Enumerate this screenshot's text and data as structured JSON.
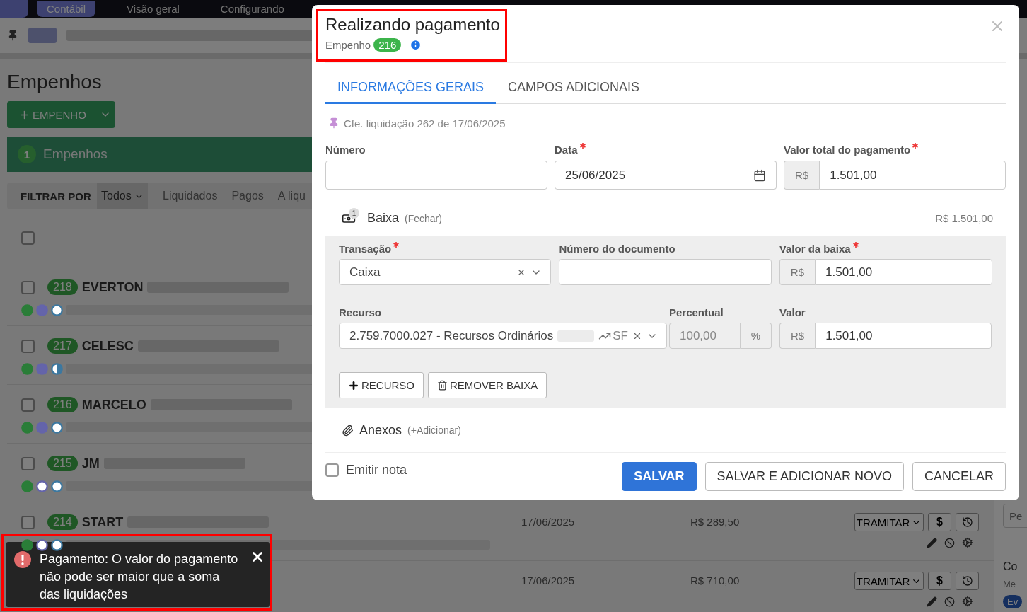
{
  "navbar": {
    "items": [
      {
        "label": "Contábil",
        "selected": true
      },
      {
        "label": "Visão geral",
        "selected": false
      },
      {
        "label": "Configurando",
        "selected": false
      }
    ]
  },
  "page": {
    "title": "Empenhos",
    "add_button": "EMPENHO",
    "summary": {
      "count": "1",
      "label": "Empenhos"
    },
    "filter": {
      "label": "FILTRAR POR",
      "options": [
        {
          "label": "Todos",
          "selected": true
        },
        {
          "label": "Liquidados",
          "selected": false
        },
        {
          "label": "Pagos",
          "selected": false
        },
        {
          "label": "A liqu",
          "selected": false
        }
      ]
    },
    "select_all_checked": false,
    "rows": [
      {
        "checked": false,
        "number": "218",
        "name": "EVERTON",
        "dots": [
          {
            "kind": "filled",
            "color": "#2a7d38"
          },
          {
            "kind": "filled",
            "color": "#6464aa"
          },
          {
            "kind": "outline",
            "color": "#3c78a0"
          }
        ]
      },
      {
        "checked": false,
        "number": "217",
        "name": "CELESC",
        "dots": [
          {
            "kind": "filled",
            "color": "#2a7d38"
          },
          {
            "kind": "filled",
            "color": "#6464aa"
          },
          {
            "kind": "half",
            "color": "#3c78a0"
          }
        ]
      },
      {
        "checked": false,
        "number": "216",
        "name": "MARCELO",
        "dots": [
          {
            "kind": "filled",
            "color": "#2a7d38"
          },
          {
            "kind": "filled",
            "color": "#6464aa"
          },
          {
            "kind": "outline",
            "color": "#3c78a0"
          }
        ]
      },
      {
        "checked": false,
        "number": "215",
        "name": "JM",
        "dots": [
          {
            "kind": "filled",
            "color": "#2a7d38"
          },
          {
            "kind": "outline",
            "color": "#6464aa"
          },
          {
            "kind": "outline",
            "color": "#3c78a0"
          }
        ]
      },
      {
        "checked": false,
        "number": "214",
        "name": "START",
        "dots": [
          {
            "kind": "filled",
            "color": "#2a7d38"
          },
          {
            "kind": "outline",
            "color": "#6464aa"
          },
          {
            "kind": "outline",
            "color": "#3c78a0"
          }
        ],
        "date": "17/06/2025",
        "amount": "R$ 289,50",
        "action": "TRAMITAR",
        "pay": "$"
      },
      {
        "date": "17/06/2025",
        "amount": "R$ 710,00",
        "action": "TRAMITAR",
        "pay": "$"
      }
    ]
  },
  "sidebar": {
    "search_placeholder": "Pe",
    "card_title": "Co",
    "card_subtitle": "Me",
    "card_tag": "Ev"
  },
  "modal": {
    "title": "Realizando pagamento",
    "subtitle": "Empenho",
    "number": "216",
    "tabs": [
      {
        "label": "INFORMAÇÕES GERAIS",
        "selected": true
      },
      {
        "label": "CAMPOS ADICIONAIS",
        "selected": false
      }
    ],
    "note": "Cfe. liquidação 262 de 17/06/2025",
    "fields": [
      {
        "kind": "text",
        "label": "Número",
        "required": false
      },
      {
        "kind": "date",
        "label": "Data",
        "required": true,
        "value": "25/06/2025"
      },
      {
        "kind": "currency",
        "label": "Valor total do pagamento",
        "required": true,
        "prefix": "R$",
        "value": "1.501,00"
      }
    ],
    "baixa": {
      "count": "1",
      "title": "Baixa",
      "toggle": "(Fechar)",
      "total": "R$ 1.501,00",
      "fields": [
        {
          "kind": "select",
          "label": "Transação",
          "required": true,
          "value": "Caixa"
        },
        {
          "kind": "text",
          "label": "Número do documento",
          "required": false
        },
        {
          "kind": "currency",
          "label": "Valor da baixa",
          "required": true,
          "prefix": "R$",
          "value": "1.501,00"
        }
      ],
      "resource_fields": [
        {
          "kind": "resource",
          "label": "Recurso",
          "required": false,
          "value": "2.759.7000.027 - Recursos Ordinários",
          "tag": "SF"
        },
        {
          "kind": "percent",
          "label": "Percentual",
          "required": false,
          "value": "100,00",
          "suffix": "%",
          "disabled": true
        },
        {
          "kind": "currency",
          "label": "Valor",
          "required": false,
          "prefix": "R$",
          "value": "1.501,00"
        }
      ],
      "buttons": [
        {
          "kind": "add",
          "label": "RECURSO"
        },
        {
          "kind": "remove",
          "label": "REMOVER BAIXA"
        }
      ]
    },
    "attachments": {
      "title": "Anexos",
      "action": "(+Adicionar)"
    },
    "emit_note": {
      "label": "Emitir nota",
      "checked": false
    },
    "buttons": [
      {
        "kind": "primary",
        "label": "SALVAR"
      },
      {
        "kind": "default",
        "label": "SALVAR E ADICIONAR NOVO"
      },
      {
        "kind": "default",
        "label": "CANCELAR"
      }
    ]
  },
  "toast": {
    "message": "Pagamento: O valor do pagamento não pode ser maior que a soma das liquidações"
  }
}
